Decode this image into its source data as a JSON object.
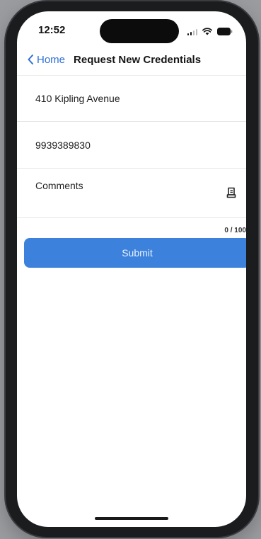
{
  "status_bar": {
    "time": "12:52",
    "icons": [
      "signal-icon",
      "wifi-icon",
      "battery-icon"
    ]
  },
  "nav": {
    "back_label": "Home",
    "title": "Request New Credentials",
    "accent_color": "#2f6fd6"
  },
  "form": {
    "address_value": "410 Kipling Avenue",
    "phone_value": "9939389830",
    "comments_placeholder": "Comments",
    "comments_counter": "0 / 100",
    "attach_icon": "document-icon"
  },
  "submit": {
    "label": "Submit",
    "color": "#3c82dc"
  }
}
